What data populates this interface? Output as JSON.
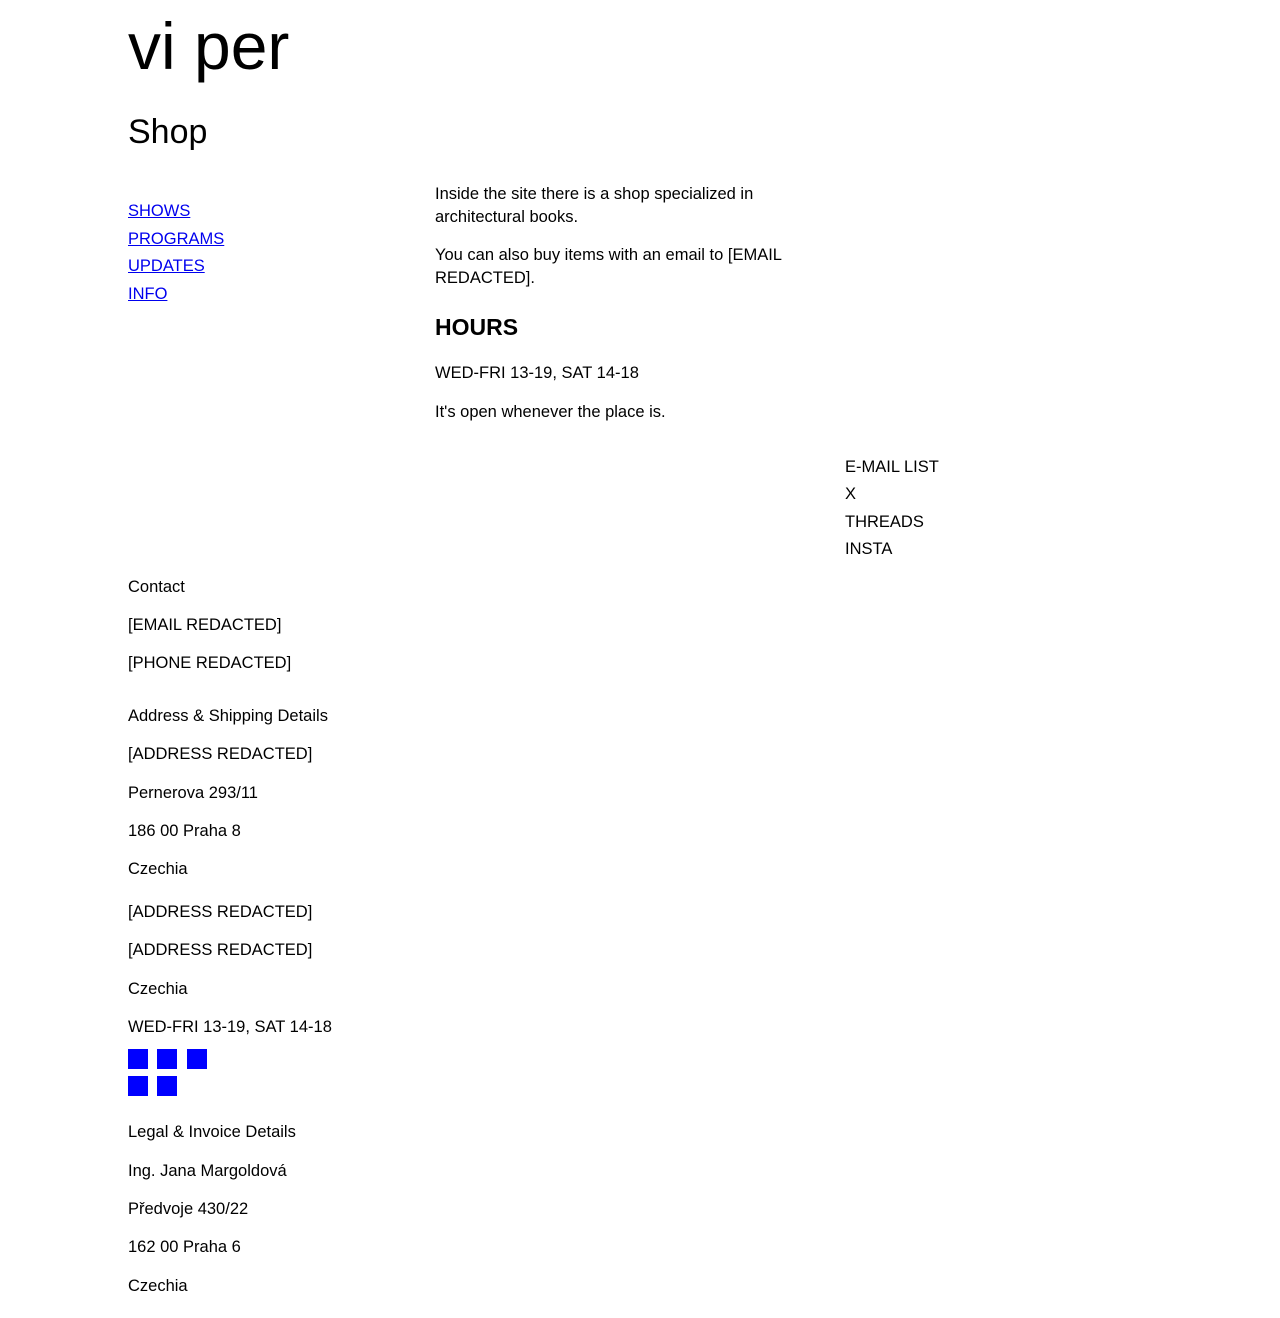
{
  "header": {
    "logo": "vi per",
    "title": "Shop"
  },
  "nav": {
    "items": [
      "SHOWS",
      "PROGRAMS",
      "UPDATES",
      "INFO"
    ]
  },
  "main": {
    "p1": "Inside the site there is a shop specialized in architectural books.",
    "p2": "You can also buy items with an email to [EMAIL REDACTED].",
    "hours_heading": "HOURS",
    "hours": "WED-FRI 13-19, SAT 14-18",
    "note": "It's open whenever the place is."
  },
  "social": {
    "items": [
      "E-MAIL LIST",
      "X",
      "THREADS",
      "INSTA"
    ]
  },
  "footer": {
    "contact": {
      "heading": "Contact",
      "email": "[EMAIL REDACTED]",
      "phone": "[PHONE REDACTED]"
    },
    "address": {
      "heading": "Address & Shipping Details",
      "line1": "[ADDRESS REDACTED]",
      "line2": "Pernerova 293/11",
      "line3": "186 00 Praha 8",
      "line4": "Czechia",
      "line5": "[ADDRESS REDACTED]",
      "line6": "[ADDRESS REDACTED]",
      "line7": "Czechia",
      "hours": "WED-FRI 13-19, SAT 14-18"
    },
    "squares": {
      "count": 5,
      "color": "#0000ff"
    },
    "legal": {
      "heading": "Legal & Invoice Details",
      "name": "Ing. Jana Margoldová",
      "street": "Předvoje 430/22",
      "city": "162 00 Praha 6",
      "country": "Czechia"
    }
  },
  "colors": {
    "link": "#0000ee",
    "accent": "#0000ff",
    "text": "#000000",
    "background": "#ffffff"
  }
}
